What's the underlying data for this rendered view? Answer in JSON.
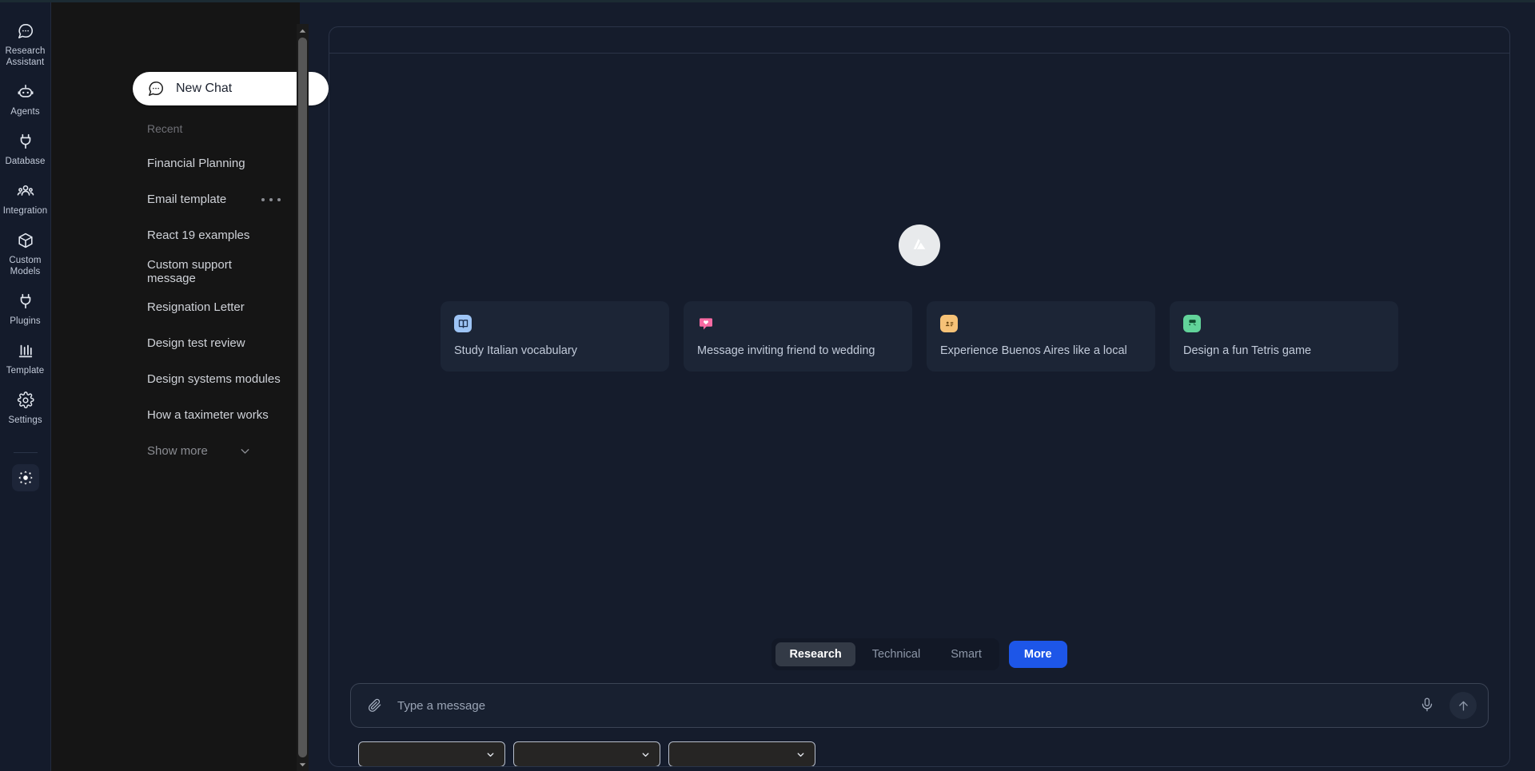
{
  "rail": {
    "items": [
      {
        "label": "Research Assistant",
        "icon": "chat-bubble-dots-icon"
      },
      {
        "label": "Agents",
        "icon": "robot-icon"
      },
      {
        "label": "Database",
        "icon": "plug-icon"
      },
      {
        "label": "Integration",
        "icon": "users-icon"
      },
      {
        "label": "Custom Models",
        "icon": "cube-icon"
      },
      {
        "label": "Plugins",
        "icon": "plug-icon"
      },
      {
        "label": "Template",
        "icon": "chart-bars-icon"
      },
      {
        "label": "Settings",
        "icon": "gear-icon"
      }
    ],
    "theme_toggle_icon": "brightness-sun-icon"
  },
  "sidebar": {
    "new_chat_label": "New Chat",
    "new_chat_icon": "chat-bubble-dots-icon",
    "recent_label": "Recent",
    "history": [
      {
        "label": "Financial Planning",
        "has_menu": false
      },
      {
        "label": "Email template",
        "has_menu": true
      },
      {
        "label": "React 19 examples",
        "has_menu": false
      },
      {
        "label": "Custom support message",
        "has_menu": false
      },
      {
        "label": "Resignation Letter",
        "has_menu": false
      },
      {
        "label": "Design test review",
        "has_menu": false
      },
      {
        "label": "Design systems modules",
        "has_menu": false
      },
      {
        "label": "How a taximeter works",
        "has_menu": false
      }
    ],
    "show_more_label": "Show more",
    "show_more_icon": "chevron-down-icon"
  },
  "main": {
    "brand_logo_icon": "triangle-a-logo",
    "suggestions": [
      {
        "label": "Study Italian vocabulary",
        "icon": "book-icon",
        "icon_bg": "#9dc4f5",
        "icon_fg": "#1b2e4d"
      },
      {
        "label": "Message inviting friend to wedding",
        "icon": "heart-message-icon",
        "icon_bg": "#f86ba3",
        "icon_fg": "#ffffff"
      },
      {
        "label": "Experience Buenos Aires like a local",
        "icon": "contact-card-icon",
        "icon_bg": "#f6c277",
        "icon_fg": "#6b4711"
      },
      {
        "label": "Design a fun Tetris game",
        "icon": "game-console-icon",
        "icon_bg": "#62d39a",
        "icon_fg": "#0f4a2e"
      }
    ],
    "modes": [
      {
        "label": "Research",
        "active": true
      },
      {
        "label": "Technical",
        "active": false
      },
      {
        "label": "Smart",
        "active": false
      }
    ],
    "more_label": "More",
    "more_color": "#1d56e8",
    "composer": {
      "placeholder": "Type a message",
      "value": "",
      "attach_icon": "paperclip-icon",
      "mic_icon": "microphone-icon",
      "send_icon": "arrow-up-icon"
    },
    "selects": [
      {
        "value": "",
        "icon": "chevron-down-icon"
      },
      {
        "value": "",
        "icon": "chevron-down-icon"
      },
      {
        "value": "",
        "icon": "chevron-down-icon"
      }
    ]
  },
  "scrollbar": {
    "up_icon": "caret-up-icon",
    "down_icon": "caret-down-icon"
  }
}
